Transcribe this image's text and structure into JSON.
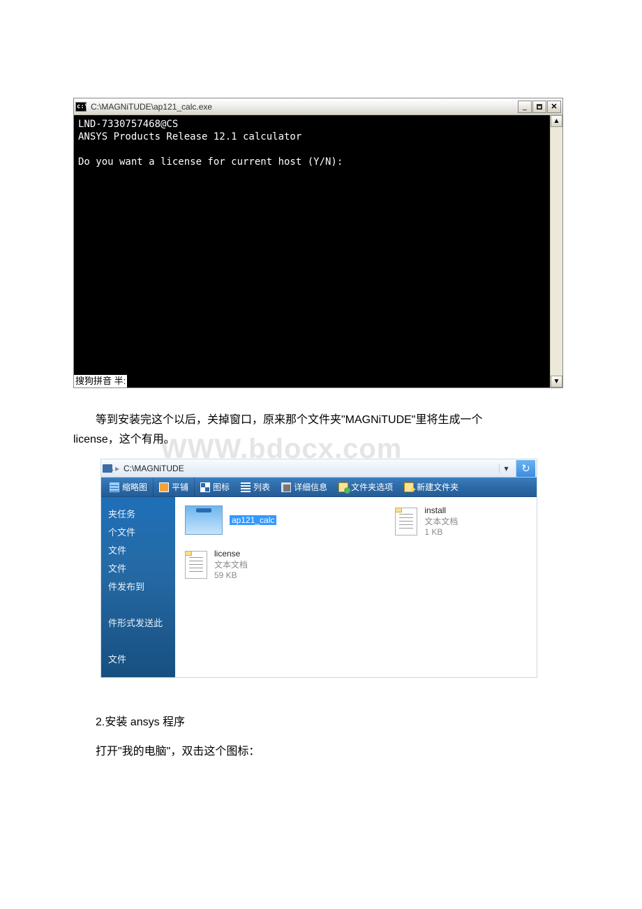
{
  "watermark": "WWW.bdocx.com",
  "console": {
    "icon_text": "c:\\",
    "title": "C:\\MAGNiTUDE\\ap121_calc.exe",
    "lines": [
      "LND-7330757468@CS",
      "ANSYS Products Release 12.1 calculator",
      "",
      "Do you want a license for current host (Y/N):"
    ],
    "ime": "搜狗拼音  半:"
  },
  "paragraph1": {
    "indent": "等到安装完这个以后，关掉窗口，原来那个文件夹\"MAGNiTUDE\"里将生成一个",
    "rest": "license，这个有用。"
  },
  "explorer": {
    "address_prefix": "▸",
    "address": "C:\\MAGNiTUDE",
    "drop": "▾",
    "refresh": "↻",
    "toolbar": {
      "thumbs": "缩略图",
      "tile": "平铺",
      "icons": "图标",
      "list": "列表",
      "details": "详细信息",
      "options": "文件夹选项",
      "newfolder": "新建文件夹"
    },
    "tasks": [
      "夹任务",
      "个文件",
      "文件",
      "文件",
      "件发布到",
      "",
      "件形式发送此",
      "",
      "文件"
    ],
    "files": {
      "app_label": "ap121_calc",
      "license": {
        "name": "license",
        "sub1": "文本文档",
        "sub2": "59 KB"
      },
      "install": {
        "name": "install",
        "sub1": "文本文档",
        "sub2": "1 KB"
      }
    }
  },
  "paragraph2": "2.安装 ansys 程序",
  "paragraph3": "打开\"我的电脑\"，双击这个图标："
}
